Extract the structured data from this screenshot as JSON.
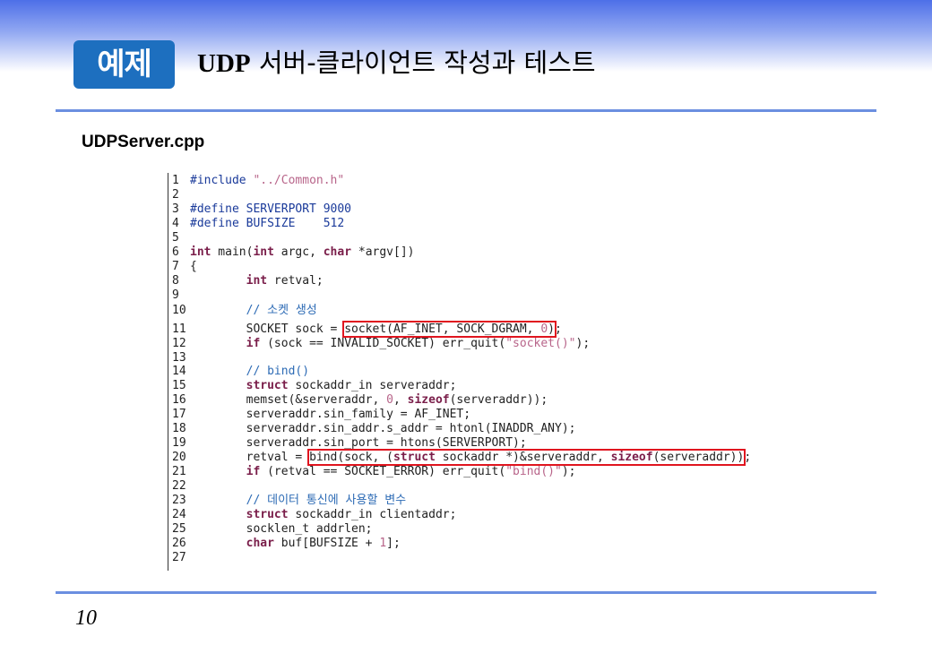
{
  "header": {
    "badge": "예제",
    "title_udp": "UDP",
    "title_rest": " 서버-클라이언트 작성과 테스트"
  },
  "filename": "UDPServer.cpp",
  "code_lines": [
    {
      "n": "1",
      "segs": [
        [
          "pp",
          "#include "
        ],
        [
          "str",
          "\"../Common.h\""
        ]
      ]
    },
    {
      "n": "2",
      "segs": []
    },
    {
      "n": "3",
      "segs": [
        [
          "pp",
          "#define SERVERPORT 9000"
        ]
      ]
    },
    {
      "n": "4",
      "segs": [
        [
          "pp",
          "#define BUFSIZE    512"
        ]
      ]
    },
    {
      "n": "5",
      "segs": []
    },
    {
      "n": "6",
      "segs": [
        [
          "kw",
          "int"
        ],
        [
          "p",
          " main("
        ],
        [
          "kw",
          "int"
        ],
        [
          "p",
          " argc, "
        ],
        [
          "kw",
          "char"
        ],
        [
          "p",
          " *argv[])"
        ]
      ]
    },
    {
      "n": "7",
      "segs": [
        [
          "p",
          "{"
        ]
      ]
    },
    {
      "n": "8",
      "segs": [
        [
          "p",
          "        "
        ],
        [
          "kw",
          "int"
        ],
        [
          "p",
          " retval;"
        ]
      ]
    },
    {
      "n": "9",
      "segs": []
    },
    {
      "n": "10",
      "segs": [
        [
          "p",
          "        "
        ],
        [
          "cmt",
          "// 소켓 생성"
        ]
      ]
    },
    {
      "n": "11",
      "segs": [
        [
          "p",
          "        SOCKET sock = "
        ],
        [
          "hl-start",
          ""
        ],
        [
          "p",
          "socket(AF_INET, SOCK_DGRAM, "
        ],
        [
          "numlit",
          "0"
        ],
        [
          "p",
          ")"
        ],
        [
          "hl-end",
          ""
        ],
        [
          "p",
          ";"
        ]
      ]
    },
    {
      "n": "12",
      "segs": [
        [
          "p",
          "        "
        ],
        [
          "kw",
          "if"
        ],
        [
          "p",
          " (sock == INVALID_SOCKET) err_quit("
        ],
        [
          "str",
          "\"socket()\""
        ],
        [
          "p",
          ");"
        ]
      ]
    },
    {
      "n": "13",
      "segs": []
    },
    {
      "n": "14",
      "segs": [
        [
          "p",
          "        "
        ],
        [
          "cmt",
          "// bind()"
        ]
      ]
    },
    {
      "n": "15",
      "segs": [
        [
          "p",
          "        "
        ],
        [
          "kw",
          "struct"
        ],
        [
          "p",
          " sockaddr_in serveraddr;"
        ]
      ]
    },
    {
      "n": "16",
      "segs": [
        [
          "p",
          "        memset(&serveraddr, "
        ],
        [
          "numlit",
          "0"
        ],
        [
          "p",
          ", "
        ],
        [
          "kw",
          "sizeof"
        ],
        [
          "p",
          "(serveraddr));"
        ]
      ]
    },
    {
      "n": "17",
      "segs": [
        [
          "p",
          "        serveraddr.sin_family = AF_INET;"
        ]
      ]
    },
    {
      "n": "18",
      "segs": [
        [
          "p",
          "        serveraddr.sin_addr.s_addr = htonl(INADDR_ANY);"
        ]
      ]
    },
    {
      "n": "19",
      "segs": [
        [
          "p",
          "        serveraddr.sin_port = htons(SERVERPORT);"
        ]
      ]
    },
    {
      "n": "20",
      "segs": [
        [
          "p",
          "        retval = "
        ],
        [
          "hl-start",
          ""
        ],
        [
          "p",
          "bind(sock, ("
        ],
        [
          "kw",
          "struct"
        ],
        [
          "p",
          " sockaddr *)&serveraddr, "
        ],
        [
          "kw",
          "sizeof"
        ],
        [
          "p",
          "(serveraddr))"
        ],
        [
          "hl-end",
          ""
        ],
        [
          "p",
          ";"
        ]
      ]
    },
    {
      "n": "21",
      "segs": [
        [
          "p",
          "        "
        ],
        [
          "kw",
          "if"
        ],
        [
          "p",
          " (retval == SOCKET_ERROR) err_quit("
        ],
        [
          "str",
          "\"bind()\""
        ],
        [
          "p",
          ");"
        ]
      ]
    },
    {
      "n": "22",
      "segs": []
    },
    {
      "n": "23",
      "segs": [
        [
          "p",
          "        "
        ],
        [
          "cmt",
          "// 데이터 통신에 사용할 변수"
        ]
      ]
    },
    {
      "n": "24",
      "segs": [
        [
          "p",
          "        "
        ],
        [
          "kw",
          "struct"
        ],
        [
          "p",
          " sockaddr_in clientaddr;"
        ]
      ]
    },
    {
      "n": "25",
      "segs": [
        [
          "p",
          "        socklen_t addrlen;"
        ]
      ]
    },
    {
      "n": "26",
      "segs": [
        [
          "p",
          "        "
        ],
        [
          "kw",
          "char"
        ],
        [
          "p",
          " buf[BUFSIZE + "
        ],
        [
          "numlit",
          "1"
        ],
        [
          "p",
          "];"
        ]
      ]
    },
    {
      "n": "27",
      "segs": []
    }
  ],
  "page_number": "10",
  "colors": {
    "accent_blue": "#1d6fbf",
    "rule_blue": "#6b8fe0",
    "highlight_red": "#e0151f"
  }
}
